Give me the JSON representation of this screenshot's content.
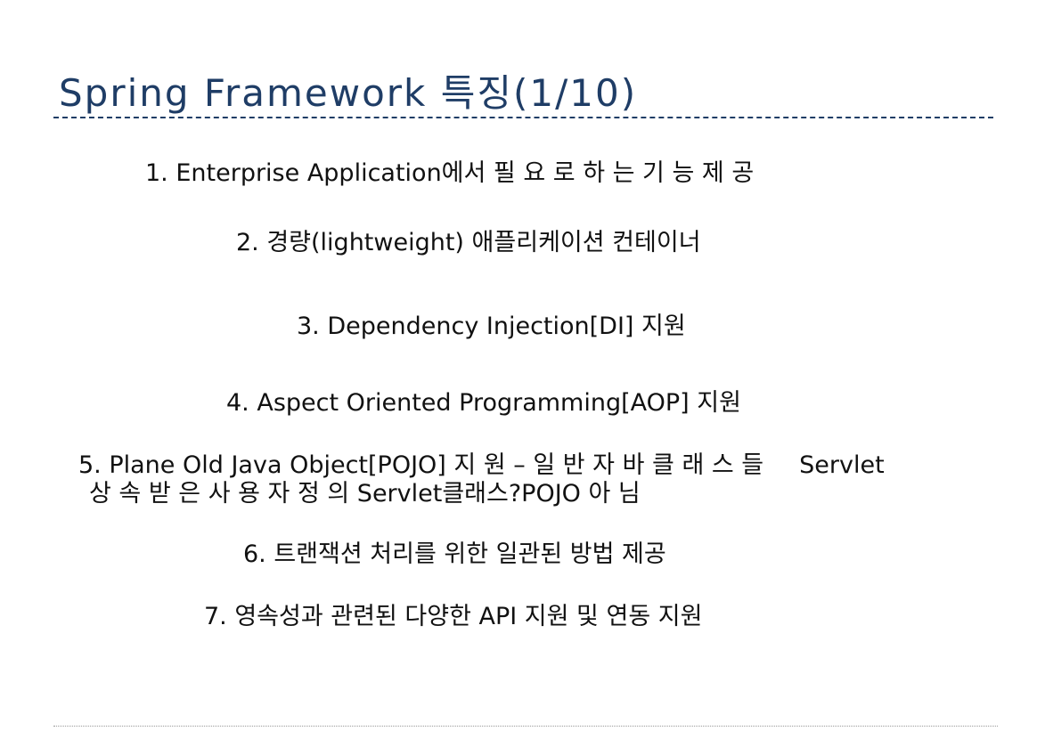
{
  "slide": {
    "title": "Spring Framework 특징(1/10)",
    "items": [
      {
        "text": "1. Enterprise Application에서 필 요 로 하 는 기 능 제 공"
      },
      {
        "text": "2. 경량(lightweight) 애플리케이션 컨테이너"
      },
      {
        "text": "3. Dependency Injection[DI] 지원"
      },
      {
        "text": "4. Aspect Oriented Programming[AOP]  지원"
      },
      {
        "line1_a": "5. Plane Old Java Object[POJO] 지 원 – 일 반 자 바 클 래 스 들",
        "line1_b": "Servlet",
        "line2": "상 속 받 은 사 용 자 정 의 Servlet클래스?POJO 아 님"
      },
      {
        "text": "6. 트랜잭션 처리를 위한 일관된 방법  제공"
      },
      {
        "text": "7. 영속성과 관련된 다양한 API 지원 및 연동 지원"
      }
    ]
  },
  "colors": {
    "title": "#1f3d66",
    "text": "#111111",
    "footer_rule": "#9a9a9a"
  }
}
